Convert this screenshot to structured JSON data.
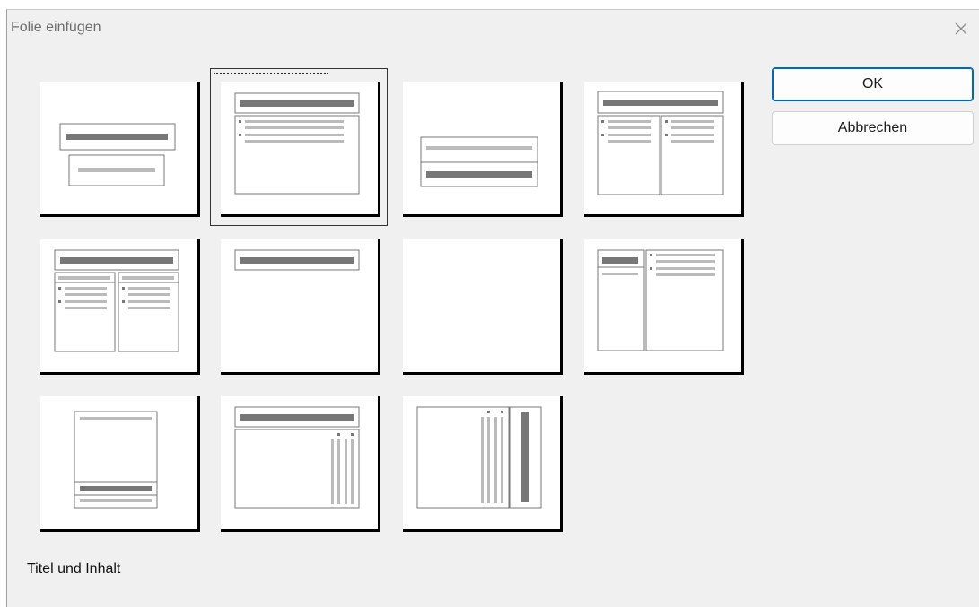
{
  "window": {
    "title": "Folie einfügen",
    "close_icon": "close-icon"
  },
  "buttons": {
    "ok_label": "OK",
    "cancel_label": "Abbrechen"
  },
  "layouts": [
    {
      "id": "title-slide",
      "selected": false
    },
    {
      "id": "title-content",
      "selected": true
    },
    {
      "id": "title-only-centered",
      "selected": false
    },
    {
      "id": "title-two-columns",
      "selected": false
    },
    {
      "id": "comparison",
      "selected": false
    },
    {
      "id": "title-only",
      "selected": false
    },
    {
      "id": "blank",
      "selected": false
    },
    {
      "id": "content-with-caption",
      "selected": false
    },
    {
      "id": "picture-with-caption",
      "selected": false
    },
    {
      "id": "title-vertical-text",
      "selected": false
    },
    {
      "id": "vertical-title-text",
      "selected": false
    }
  ],
  "status": {
    "selected_layout_name": "Titel und Inhalt"
  },
  "colors": {
    "accent": "#0067c0",
    "dialog_bg": "#f0f0f0",
    "placeholder_dark": "#777777",
    "placeholder_light": "#bbbbbb"
  }
}
